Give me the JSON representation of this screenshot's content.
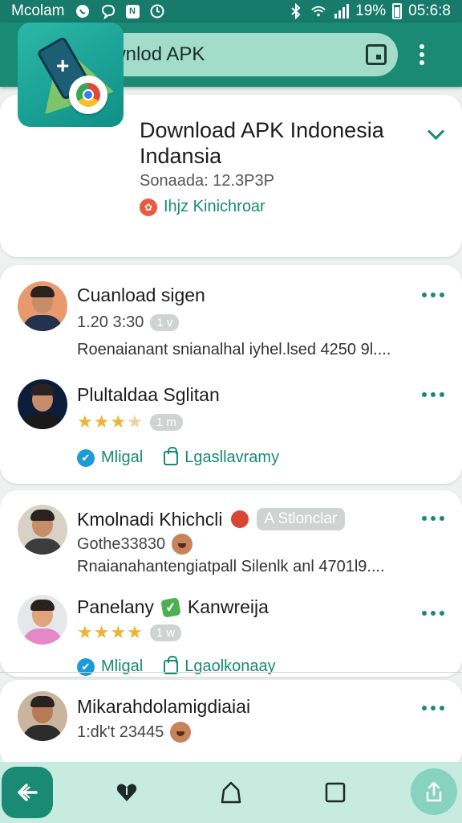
{
  "status_bar": {
    "carrier": "Mcolam",
    "battery": "19%",
    "time": "05:6:8"
  },
  "app_bar": {
    "search_text": "wwnlod APK"
  },
  "app_card": {
    "title_line1": "Download APK Indonesia",
    "title_line2": "Indansia",
    "size": "Sonaada: 12.3P3P",
    "developer": "Ihjz Kinichroar"
  },
  "reviews": [
    {
      "name": "Cuanload sigen",
      "meta": "1.20 3:30",
      "chip": "1 v",
      "text": "Roenaianant snianalhal iyhel.lsed 4250 9l...."
    },
    {
      "name": "Plultaldaa Sglitan",
      "chip": "1 m",
      "stars": 4,
      "action1": "Mligal",
      "action2": "Lgasllavramy"
    },
    {
      "name": "Kmolnadi Khichcli",
      "chip": "A Stlonclar",
      "meta": "Gothe33830",
      "text": "Rnaianahantengiatpall Silenlk anl 4701l9...."
    },
    {
      "name": "Panelany",
      "name2": "Kanwreija",
      "chip": "1 w",
      "stars": 4,
      "action1": "Mligal",
      "action2": "Lgaolkonaay"
    },
    {
      "name": "Mikarahdolamigdiaiai",
      "meta": "1:dk't 23445"
    }
  ],
  "colors": {
    "primary": "#1a8a75",
    "status_bar": "#177a6a",
    "search_bg": "#a3dcc9",
    "accent_text": "#178a73",
    "star": "#f0b232",
    "nav_bg": "#c8ebe0"
  },
  "icons": {
    "back": "arrow-left",
    "search": "magnifier",
    "scan": "qr-scan",
    "menu": "vertical-dots",
    "expand": "chevron-down",
    "nav_home": "house",
    "nav_recent": "square",
    "nav_share": "share-up"
  }
}
